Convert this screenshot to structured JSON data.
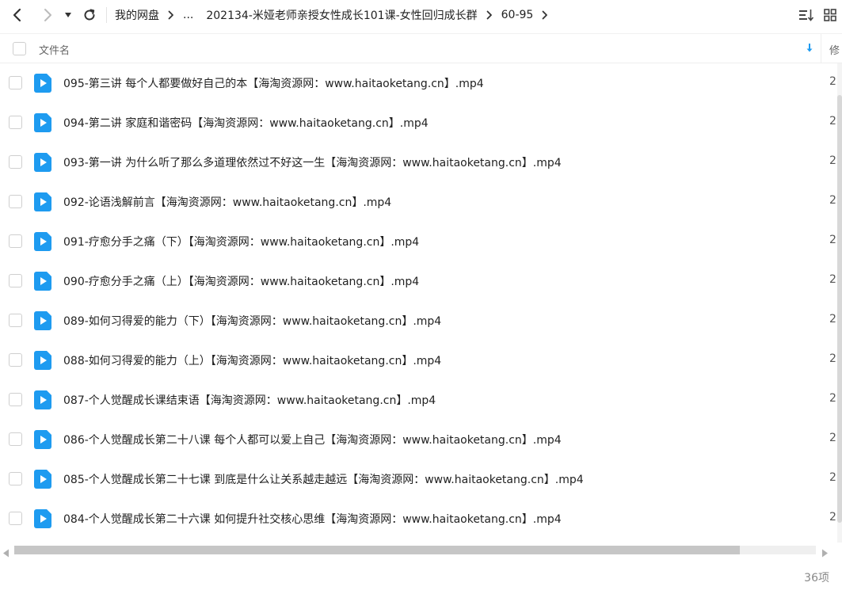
{
  "icons": {
    "back": "chevron-left-icon",
    "forward": "chevron-right-icon",
    "dropdown": "caret-down-icon",
    "refresh": "refresh-icon",
    "sort": "sort-icon",
    "grid": "grid-view-icon",
    "file": "video-file-icon"
  },
  "colors": {
    "accent": "#1e9bf0",
    "text": "#222222",
    "muted": "#888888"
  },
  "breadcrumb": {
    "items": [
      "我的网盘",
      "...",
      "202134-米娅老师亲授女性成长101课-女性回归成长群",
      "60-95"
    ]
  },
  "header": {
    "name_label": "文件名",
    "modified_label": "修"
  },
  "files": [
    {
      "name": "095-第三讲  每个人都要做好自己的本【海淘资源网：www.haitaoketang.cn】.mp4",
      "date": "2"
    },
    {
      "name": "094-第二讲  家庭和谐密码【海淘资源网：www.haitaoketang.cn】.mp4",
      "date": "2"
    },
    {
      "name": "093-第一讲  为什么听了那么多道理依然过不好这一生【海淘资源网：www.haitaoketang.cn】.mp4",
      "date": "2"
    },
    {
      "name": "092-论语浅解前言【海淘资源网：www.haitaoketang.cn】.mp4",
      "date": "2"
    },
    {
      "name": "091-疗愈分手之痛（下）【海淘资源网：www.haitaoketang.cn】.mp4",
      "date": "2"
    },
    {
      "name": "090-疗愈分手之痛（上）【海淘资源网：www.haitaoketang.cn】.mp4",
      "date": "2"
    },
    {
      "name": "089-如何习得爱的能力（下）【海淘资源网：www.haitaoketang.cn】.mp4",
      "date": "2"
    },
    {
      "name": "088-如何习得爱的能力（上）【海淘资源网：www.haitaoketang.cn】.mp4",
      "date": "2"
    },
    {
      "name": "087-个人觉醒成长课结束语【海淘资源网：www.haitaoketang.cn】.mp4",
      "date": "2"
    },
    {
      "name": "086-个人觉醒成长第二十八课 每个人都可以爱上自己【海淘资源网：www.haitaoketang.cn】.mp4",
      "date": "2"
    },
    {
      "name": "085-个人觉醒成长第二十七课 到底是什么让关系越走越远【海淘资源网：www.haitaoketang.cn】.mp4",
      "date": "2"
    },
    {
      "name": "084-个人觉醒成长第二十六课  如何提升社交核心思维【海淘资源网：www.haitaoketang.cn】.mp4",
      "date": "2"
    }
  ],
  "footer": {
    "item_count": "36项"
  }
}
